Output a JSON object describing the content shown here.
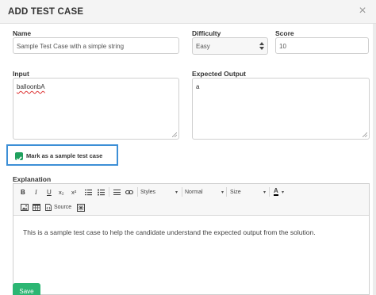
{
  "modal": {
    "title": "ADD TEST CASE",
    "close_symbol": "×"
  },
  "form": {
    "name_label": "Name",
    "name_value": "Sample Test Case with a simple string",
    "difficulty_label": "Difficulty",
    "difficulty_value": "Easy",
    "score_label": "Score",
    "score_value": "10",
    "input_label": "Input",
    "input_value": "balloonbA",
    "expected_label": "Expected Output",
    "expected_value": "a",
    "sample_checkbox_label": "Mark as a sample test case",
    "sample_checked": true,
    "explanation_label": "Explanation"
  },
  "toolbar": {
    "bold": "B",
    "italic": "I",
    "underline": "U",
    "subscript": "x₂",
    "superscript": "x²",
    "styles_label": "Styles",
    "format_label": "Normal",
    "size_label": "Size",
    "color_label": "A",
    "source_label": "Source",
    "dropdown_arrow": "▾"
  },
  "editor": {
    "content": "This is a sample test case to help the candidate understand the expected output from the solution."
  },
  "actions": {
    "save_label": "Save"
  },
  "colors": {
    "accent_green": "#2cb673",
    "focus_blue": "#3d8fd6"
  }
}
